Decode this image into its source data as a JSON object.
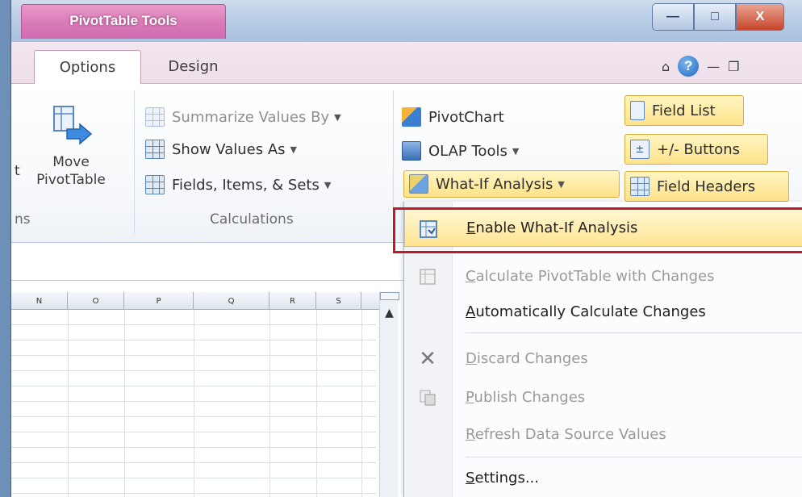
{
  "titlebar": {
    "context_tab_label": "PivotTable Tools",
    "window_buttons": [
      "—",
      "□",
      "X"
    ],
    "colors": {
      "context_tab": "#d97ab7",
      "close_button": "#c7452a"
    }
  },
  "tabs": [
    {
      "label": "Options",
      "selected": true
    },
    {
      "label": "Design",
      "selected": false
    }
  ],
  "ribbon": {
    "left_group_label": "ns",
    "left_partial_text": "t",
    "move_pivottable": {
      "line1": "Move",
      "line2": "PivotTable"
    },
    "calculations": {
      "label": "Calculations",
      "items": [
        {
          "label": "Summarize Values By",
          "disabled": true
        },
        {
          "label": "Show Values As",
          "disabled": false
        },
        {
          "label": "Fields, Items, & Sets",
          "disabled": false
        }
      ]
    },
    "tools": {
      "items": [
        {
          "label": "PivotChart"
        },
        {
          "label": "OLAP Tools"
        },
        {
          "label": "What-If Analysis",
          "highlighted": true
        }
      ]
    },
    "show": {
      "items": [
        {
          "label": "Field List",
          "highlighted": true
        },
        {
          "label": "+/- Buttons",
          "highlighted": true
        },
        {
          "label": "Field Headers",
          "highlighted": true
        }
      ]
    }
  },
  "sheet": {
    "columns": [
      "N",
      "O",
      "P",
      "Q",
      "R",
      "S"
    ]
  },
  "menu": {
    "items": [
      {
        "label": "Enable What-If Analysis",
        "accel": "E",
        "rest": "nable What-If Analysis",
        "disabled": false,
        "active": true
      },
      {
        "label": "Calculate PivotTable with Changes",
        "accel": "C",
        "rest": "alculate PivotTable with Changes",
        "disabled": true
      },
      {
        "label": "Automatically Calculate Changes",
        "accel": "A",
        "rest": "utomatically Calculate Changes",
        "disabled": false
      },
      {
        "label": "Discard Changes",
        "accel": "D",
        "rest": "iscard Changes",
        "disabled": true
      },
      {
        "label": "Publish Changes",
        "accel": "P",
        "rest": "ublish Changes",
        "disabled": true
      },
      {
        "label": "Refresh Data Source Values",
        "accel": "R",
        "rest": "efresh Data Source Values",
        "disabled": true
      },
      {
        "label": "Settings...",
        "accel": "S",
        "rest": "ettings...",
        "disabled": false
      }
    ],
    "highlight_color": "#c0182b"
  }
}
